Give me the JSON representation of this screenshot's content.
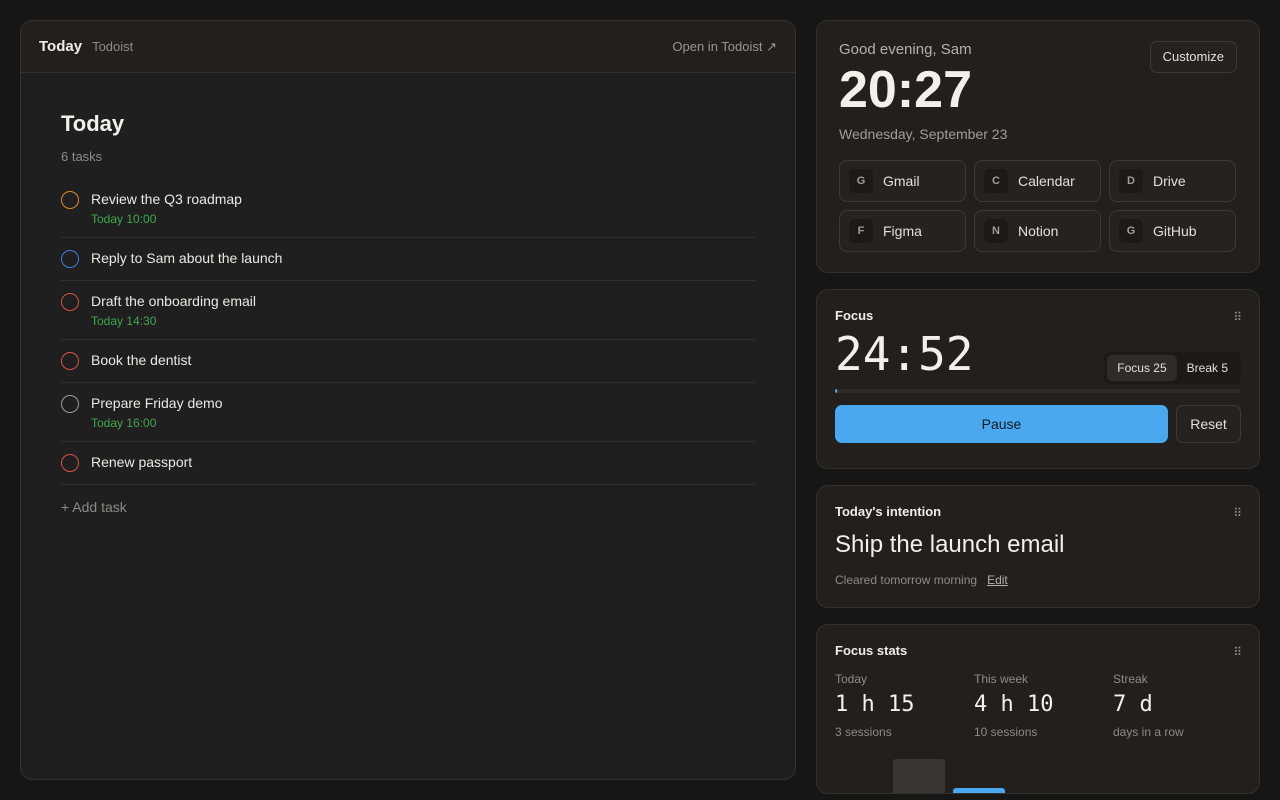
{
  "header": {
    "title": "Today",
    "source": "Todoist",
    "open_label": "Open in Todoist ↗"
  },
  "tasks_panel": {
    "heading": "Today",
    "count": "6 tasks",
    "add_label": "+ Add task",
    "items": [
      {
        "title": "Review the Q3 roadmap",
        "due": "Today 10:00",
        "ring": "#e08a2e"
      },
      {
        "title": "Reply to Sam about the launch",
        "due": "",
        "ring": "#3c7ee0"
      },
      {
        "title": "Draft the onboarding email",
        "due": "Today 14:30",
        "ring": "#d9503f"
      },
      {
        "title": "Book the dentist",
        "due": "",
        "ring": "#d9503f"
      },
      {
        "title": "Prepare Friday demo",
        "due": "Today 16:00",
        "ring": "#a09a93"
      },
      {
        "title": "Renew passport",
        "due": "",
        "ring": "#d9503f"
      }
    ]
  },
  "greeting": {
    "text": "Good evening, Sam",
    "clock": "20:27",
    "date": "Wednesday, September 23",
    "customize_label": "Customize",
    "shortcuts": [
      {
        "badge": "G",
        "name": "Gmail"
      },
      {
        "badge": "C",
        "name": "Calendar"
      },
      {
        "badge": "D",
        "name": "Drive"
      },
      {
        "badge": "F",
        "name": "Figma"
      },
      {
        "badge": "N",
        "name": "Notion"
      },
      {
        "badge": "G",
        "name": "GitHub"
      }
    ]
  },
  "focus": {
    "title": "Focus",
    "timer": "24:52",
    "mode_focus": "Focus 25",
    "mode_break": "Break 5",
    "progress_fraction": 0.005,
    "pause_label": "Pause",
    "reset_label": "Reset",
    "drag_icon": "⠿"
  },
  "intention": {
    "title": "Today's intention",
    "text": "Ship the launch email",
    "meta": "Cleared tomorrow morning",
    "edit_label": "Edit"
  },
  "stats": {
    "title": "Focus stats",
    "items": [
      {
        "label": "Today",
        "value": "1 h 15",
        "sub": "3 sessions"
      },
      {
        "label": "This week",
        "value": "4 h 10",
        "sub": "10 sessions"
      },
      {
        "label": "Streak",
        "value": "7 d",
        "sub": "days in a row"
      }
    ],
    "bars": [
      {
        "value": 1.0,
        "color": "#3a3633"
      },
      {
        "value": 0.15,
        "color": "#4aa8f0"
      }
    ]
  },
  "colors": {
    "accent": "#4aa8f0",
    "due_green": "#3fa84d"
  }
}
